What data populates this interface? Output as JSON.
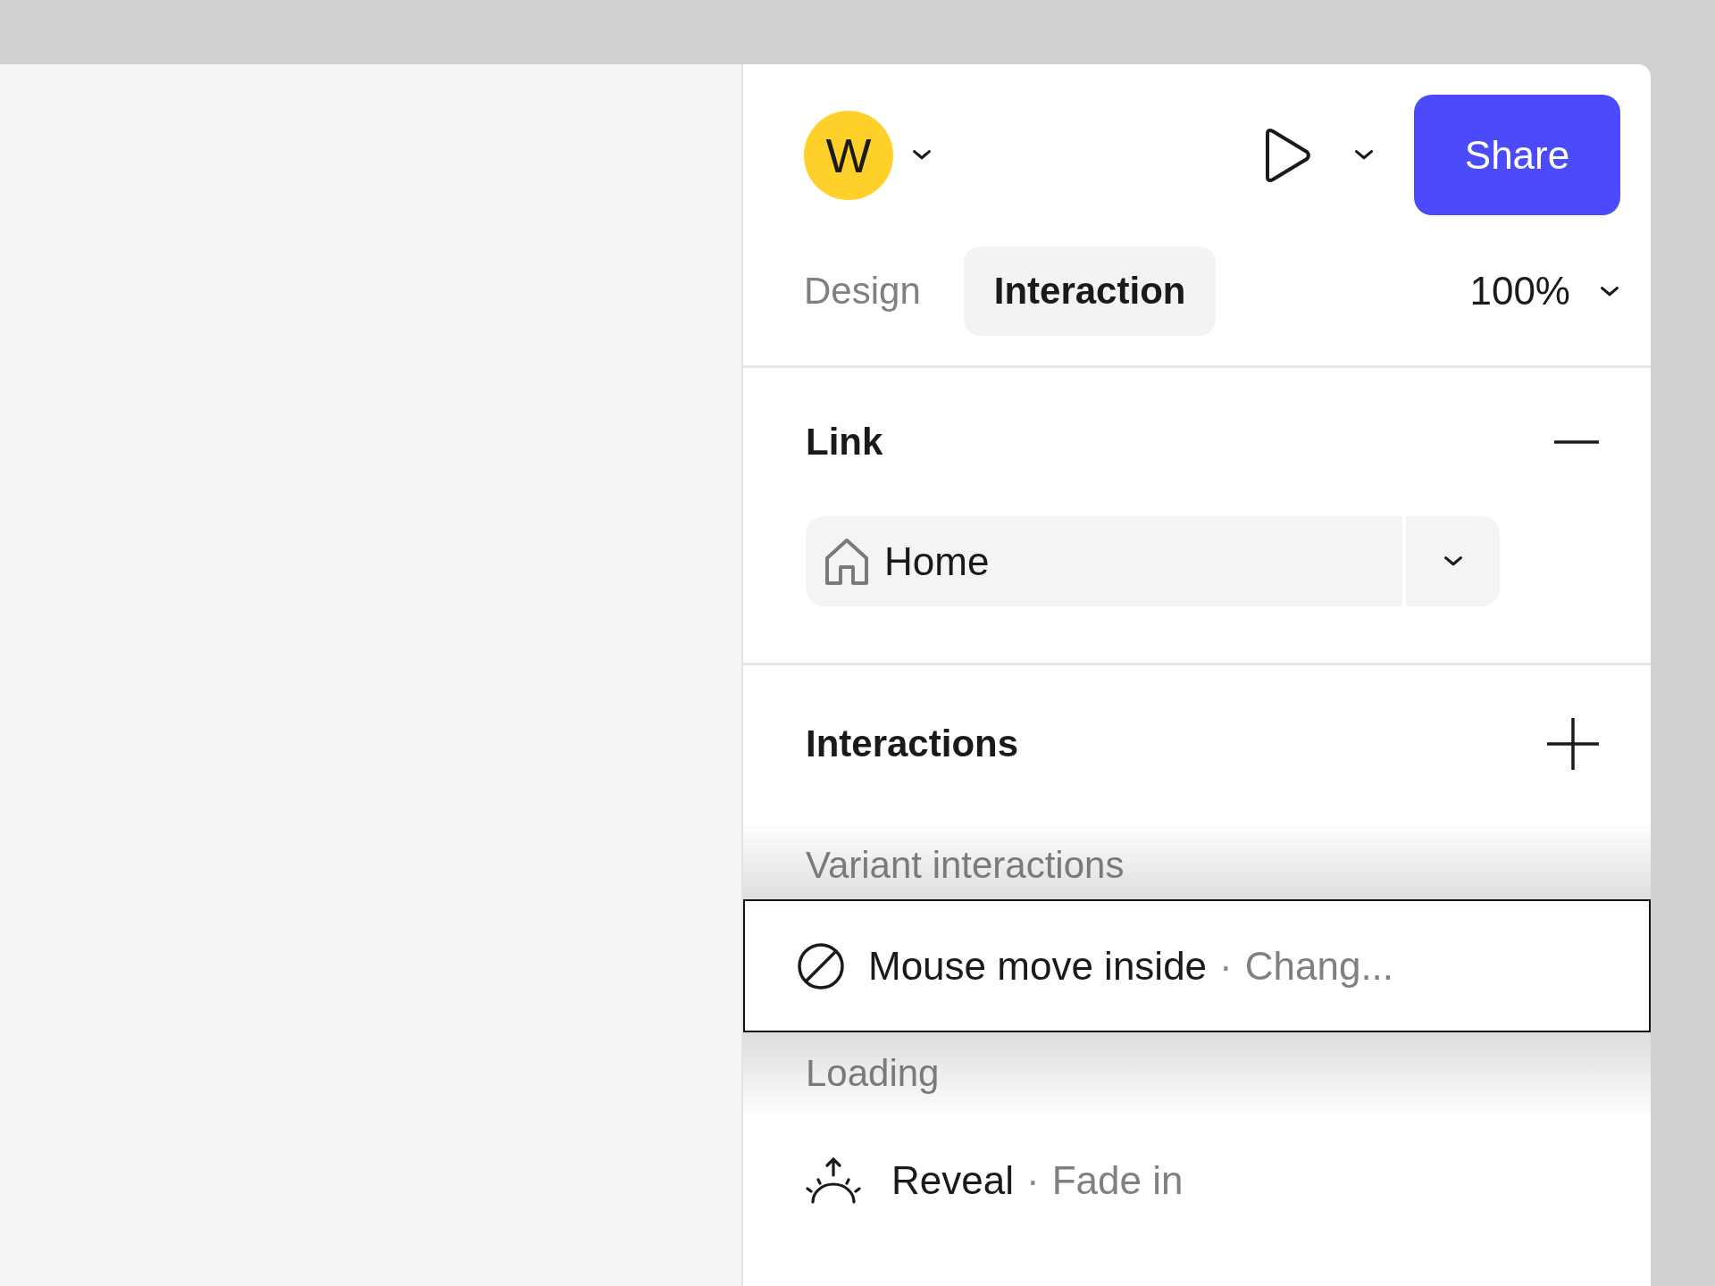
{
  "user": {
    "initial": "W"
  },
  "share_button": "Share",
  "tabs": [
    {
      "label": "Design",
      "selected": false
    },
    {
      "label": "Interaction",
      "selected": true
    }
  ],
  "zoom": "100%",
  "link": {
    "title": "Link",
    "expanded": true,
    "page": "Home"
  },
  "interactions": {
    "title": "Interactions",
    "groups": [
      {
        "label": "Variant interactions",
        "items": [
          {
            "kind": "blocked",
            "trigger": "Mouse move inside",
            "separator": "·",
            "action": "Chang...",
            "selected": true
          }
        ]
      },
      {
        "label": "Loading",
        "items": [
          {
            "kind": "reveal",
            "trigger": "Reveal",
            "separator": "·",
            "action": "Fade in",
            "selected": false
          }
        ]
      }
    ]
  }
}
